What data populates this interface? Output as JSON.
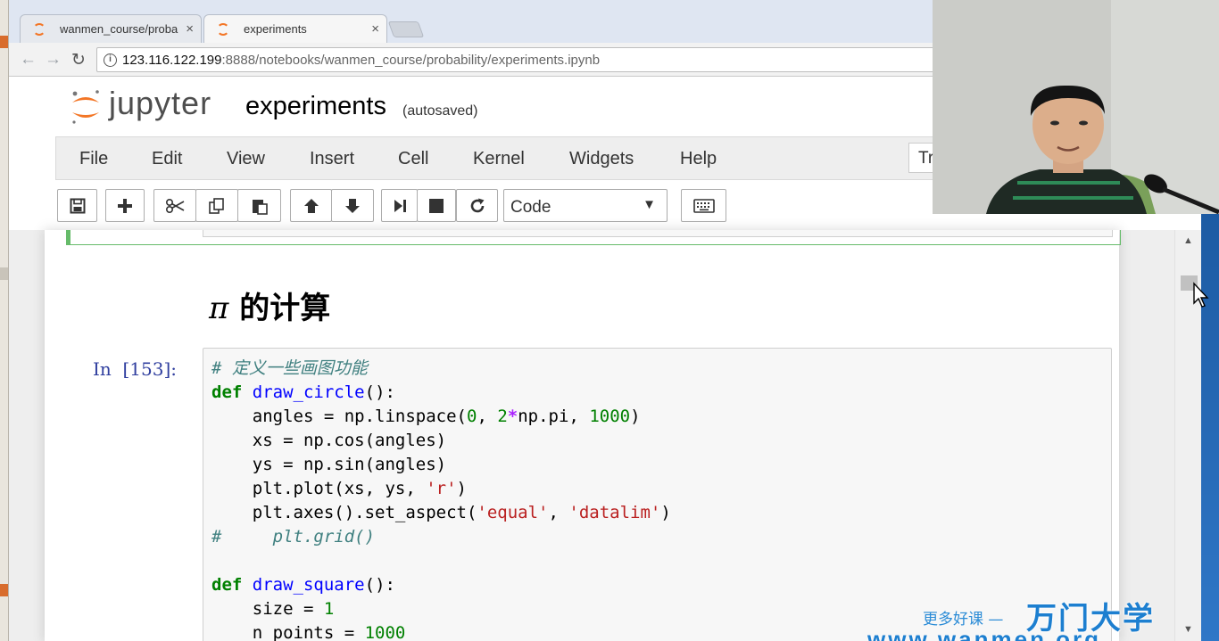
{
  "browser": {
    "tabs": [
      {
        "title": "wanmen_course/proba",
        "close": "×"
      },
      {
        "title": "experiments",
        "close": "×"
      }
    ],
    "url_host": "123.116.122.199",
    "url_rest": ":8888/notebooks/wanmen_course/probability/experiments.ipynb",
    "info_glyph": "i"
  },
  "jupyter": {
    "wordmark": "jupyter",
    "notebook_title": "experiments",
    "autosave_status": "(autosaved)",
    "menu": [
      "File",
      "Edit",
      "View",
      "Insert",
      "Cell",
      "Kernel",
      "Widgets",
      "Help"
    ],
    "kernel_indicator": "Tr",
    "cell_type": "Code",
    "toolbar_icons": [
      "save-icon",
      "plus-icon",
      "cut-icon",
      "copy-icon",
      "paste-icon",
      "arrow-up-icon",
      "arrow-down-icon",
      "run-icon",
      "stop-icon",
      "restart-icon",
      "keyboard-icon"
    ]
  },
  "notebook": {
    "heading_pi": "π",
    "heading_text": " 的计算",
    "cell_prompt": "In  [153]:",
    "code": {
      "l1_comment": "# 定义一些画图功能",
      "l2_def": "def",
      "l2_fn": "draw_circle",
      "l2_rest": "():",
      "l3_a": "    angles = np.linspace(",
      "l3_n0": "0",
      "l3_b": ", ",
      "l3_n2": "2",
      "l3_op": "*",
      "l3_c": "np.pi, ",
      "l3_n1000": "1000",
      "l3_d": ")",
      "l4": "    xs = np.cos(angles)",
      "l5": "    ys = np.sin(angles)",
      "l6_a": "    plt.plot(xs, ys, ",
      "l6_s": "'r'",
      "l6_b": ")",
      "l7_a": "    plt.axes().set_aspect(",
      "l7_s1": "'equal'",
      "l7_b": ", ",
      "l7_s2": "'datalim'",
      "l7_c": ")",
      "l8_comment": "#     plt.grid()",
      "l10_def": "def",
      "l10_fn": "draw_square",
      "l10_rest": "():",
      "l11_a": "    size = ",
      "l11_n": "1",
      "l12_a": "    n_points = ",
      "l12_n": "1000"
    }
  },
  "watermark": {
    "small": "更多好课 —",
    "big": "万门大学",
    "url": "www.wanmen.org"
  },
  "colors": {
    "jupyter_orange": "#f37626",
    "prompt_blue": "#303f9f",
    "keyword_green": "#008000",
    "string_red": "#ba2121",
    "comment_teal": "#408080"
  }
}
